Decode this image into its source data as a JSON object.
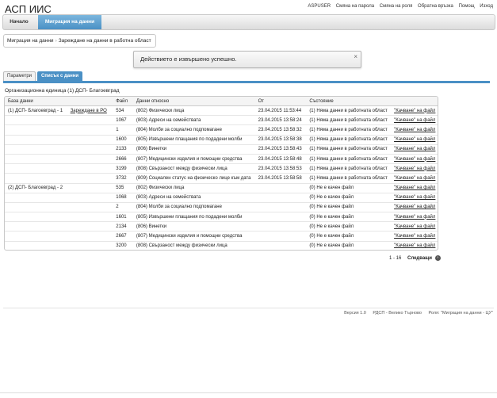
{
  "app": {
    "title": "АСП ИИС"
  },
  "top_links": [
    "ASPUSER",
    "Смяна на парола",
    "Смяна на роля",
    "Обратна връзка",
    "Помощ",
    "Изход"
  ],
  "nav": {
    "home": "Начало",
    "active": "Миграция на данни"
  },
  "breadcrumb": {
    "item1": "Миграция на данни",
    "item2": "Зареждане на данни в работна област"
  },
  "notice": {
    "message": "Действието е извършено успешно.",
    "close": "×"
  },
  "tabs": {
    "params": "Параметри",
    "list": "Списък с данни"
  },
  "org_unit": "Организационна единица (1) ДСП- Благоевград",
  "table": {
    "headers": [
      "База данни",
      "",
      "Файл",
      "Данни относно",
      "От",
      "Състояние",
      ""
    ],
    "rows": [
      [
        "(1) ДСП- Благоевград - 1",
        "Зареждане в РО",
        "534",
        "(802) Физически лица",
        "23.04.2015 11:53:44",
        "(1) Няма данни в работната област",
        "\"Качване\" на файл"
      ],
      [
        "",
        "",
        "1067",
        "(803) Адреси на семействата",
        "23.04.2015 13:58:24",
        "(1) Няма данни в работната област",
        "\"Качване\" на файл"
      ],
      [
        "",
        "",
        "1",
        "(804) Молби за социално подпомагане",
        "23.04.2015 13:58:32",
        "(1) Няма данни в работната област",
        "\"Качване\" на файл"
      ],
      [
        "",
        "",
        "1600",
        "(805) Извършени плащания по подадени молби",
        "23.04.2015 13:58:38",
        "(1) Няма данни в работната област",
        "\"Качване\" на файл"
      ],
      [
        "",
        "",
        "2133",
        "(806) Винетки",
        "23.04.2015 13:58:43",
        "(1) Няма данни в работната област",
        "\"Качване\" на файл"
      ],
      [
        "",
        "",
        "2666",
        "(807) Медицински изделия и помощни средства",
        "23.04.2015 13:58:48",
        "(1) Няма данни в работната област",
        "\"Качване\" на файл"
      ],
      [
        "",
        "",
        "3199",
        "(808) Свързаност между физически лица",
        "23.04.2015 13:58:53",
        "(1) Няма данни в работната област",
        "\"Качване\" на файл"
      ],
      [
        "",
        "",
        "3732",
        "(809) Социален статус на физическо лице към дата",
        "23.04.2015 13:58:58",
        "(1) Няма данни в работната област",
        "\"Качване\" на файл"
      ],
      [
        "(2) ДСП- Благоевград - 2",
        "",
        "535",
        "(802) Физически лица",
        "",
        "(0) Не е качен файл",
        "\"Качване\" на файл"
      ],
      [
        "",
        "",
        "1068",
        "(803) Адреси на семействата",
        "",
        "(0) Не е качен файл",
        "\"Качване\" на файл"
      ],
      [
        "",
        "",
        "2",
        "(804) Молби за социално подпомагане",
        "",
        "(0) Не е качен файл",
        "\"Качване\" на файл"
      ],
      [
        "",
        "",
        "1601",
        "(805) Извършени плащания по подадени молби",
        "",
        "(0) Не е качен файл",
        "\"Качване\" на файл"
      ],
      [
        "",
        "",
        "2134",
        "(806) Винетки",
        "",
        "(0) Не е качен файл",
        "\"Качване\" на файл"
      ],
      [
        "",
        "",
        "2667",
        "(807) Медицински изделия и помощни средства",
        "",
        "(0) Не е качен файл",
        "\"Качване\" на файл"
      ],
      [
        "",
        "",
        "3200",
        "(808) Свързаност между физически лица",
        "",
        "(0) Не е качен файл",
        "\"Качване\" на файл"
      ],
      [
        "",
        "",
        "3733",
        "(809) Социален статус на физическо лице към дата",
        "",
        "(0) Не е качен файл",
        "\"Качване\" на файл"
      ]
    ]
  },
  "pager": {
    "range": "1 - 16",
    "next": "Следващи",
    "arrow": "›"
  },
  "footer": {
    "version": "Версия 1.0",
    "org": "РДСП - Велико Търново",
    "role": "Роля: \"Миграция на данни - ЦУ\""
  },
  "icons": {
    "close": "close-icon",
    "next": "next-arrow-icon"
  },
  "colors": {
    "accent": "#4a90c5"
  }
}
